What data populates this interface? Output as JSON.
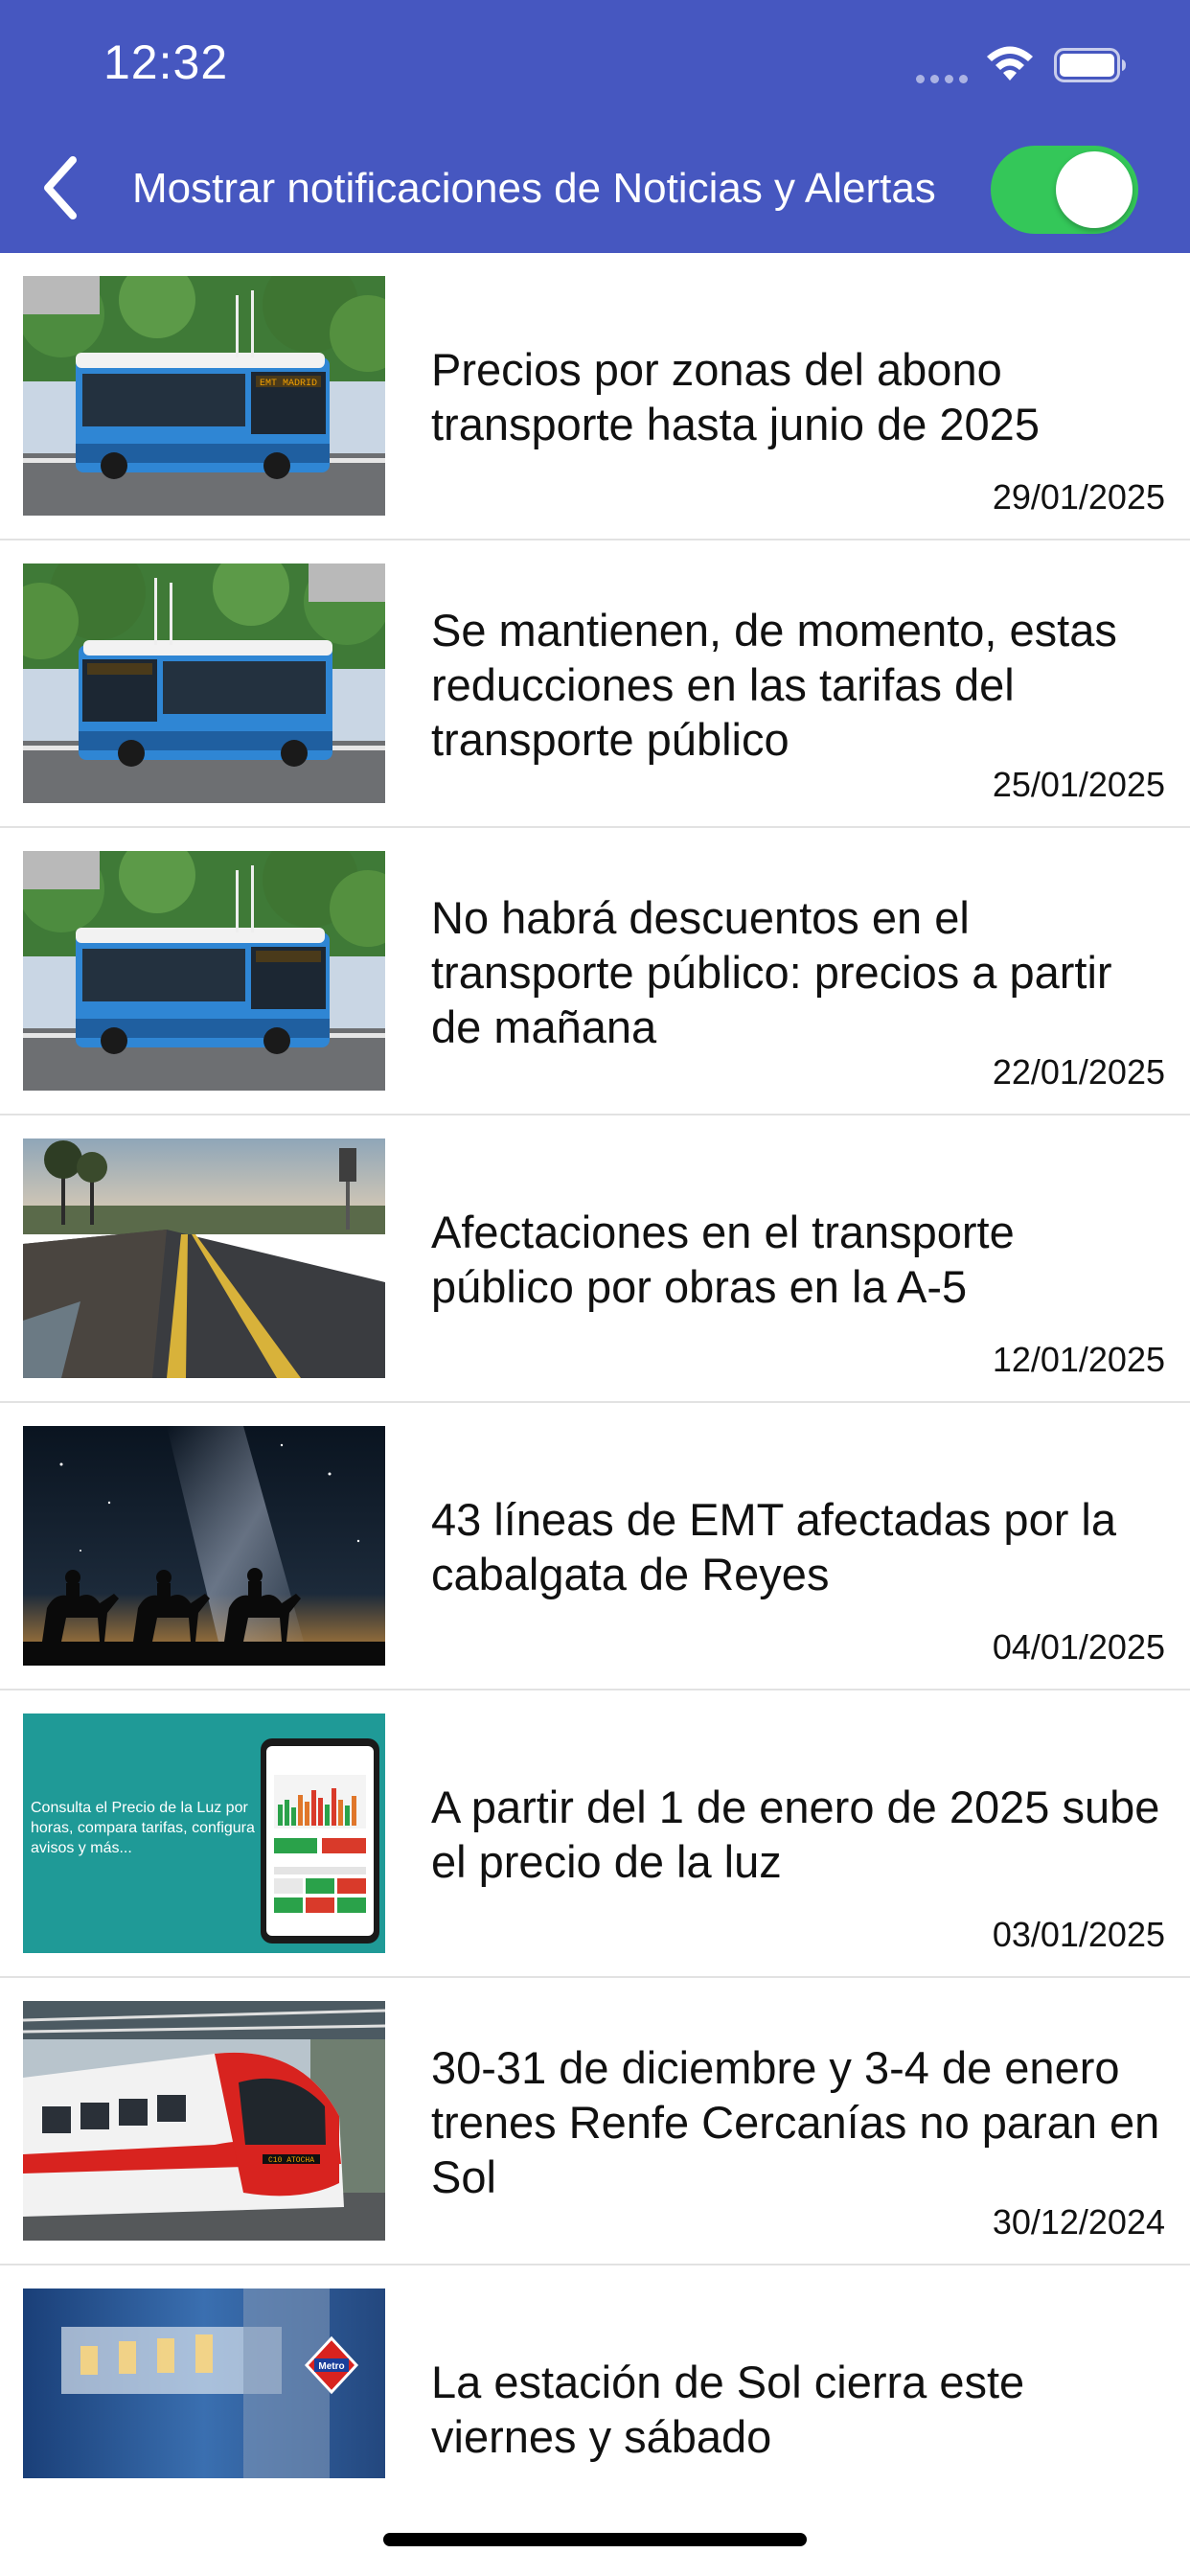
{
  "status_bar": {
    "time": "12:32"
  },
  "header": {
    "title": "Mostrar notificaciones de Noticias y Alertas",
    "toggle_on": true,
    "color": "#4657c0",
    "toggle_color": "#34c759"
  },
  "news": [
    {
      "title": "Precios por zonas del abono transporte hasta junio de 2025",
      "date": "29/01/2025",
      "image": "emt-bus"
    },
    {
      "title": "Se mantienen, de momento, estas reducciones en las tarifas del transporte público",
      "date": "25/01/2025",
      "image": "emt-bus"
    },
    {
      "title": "No habrá descuentos en el transporte público: precios a partir de mañana",
      "date": "22/01/2025",
      "image": "emt-bus"
    },
    {
      "title": "Afectaciones en el transporte público por obras en la A-5",
      "date": "12/01/2025",
      "image": "road"
    },
    {
      "title": "43 líneas de EMT afectadas por la cabalgata de Reyes",
      "date": "04/01/2025",
      "image": "camels-night"
    },
    {
      "title": "A partir del 1 de enero de 2025 sube el precio de la luz",
      "date": "03/01/2025",
      "image": "electricity-app",
      "image_text": "Consulta el Precio de la Luz por horas, compara tarifas, configura avisos y más..."
    },
    {
      "title": "30-31 de diciembre y 3-4 de enero trenes Renfe Cercanías no paran en Sol",
      "date": "30/12/2024",
      "image": "renfe-train"
    },
    {
      "title": "La estación de Sol cierra este viernes y sábado",
      "date": "",
      "image": "metro-station"
    }
  ]
}
